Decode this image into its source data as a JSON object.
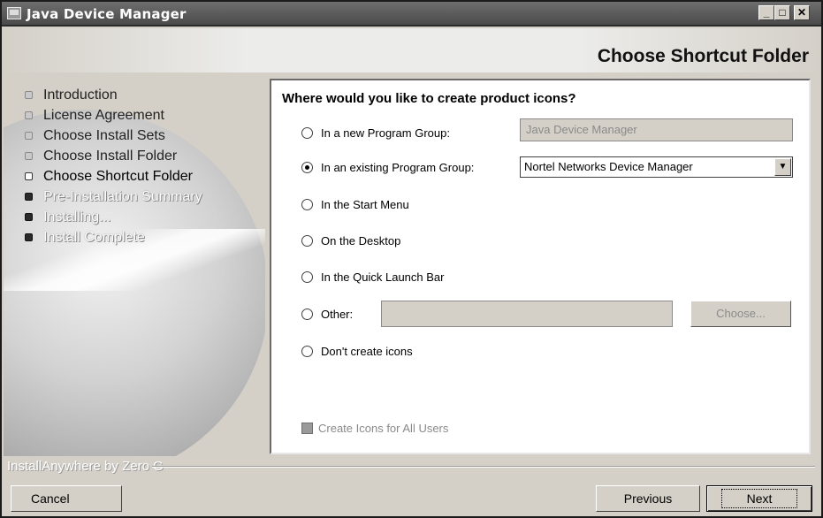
{
  "window": {
    "title": "Java Device Manager",
    "controls": {
      "minimize": "_",
      "maximize": "□",
      "close": "✕"
    }
  },
  "page": {
    "heading": "Choose Shortcut Folder"
  },
  "sidebar": {
    "steps": [
      {
        "label": "Introduction",
        "state": "done"
      },
      {
        "label": "License Agreement",
        "state": "done"
      },
      {
        "label": "Choose Install Sets",
        "state": "done"
      },
      {
        "label": "Choose Install Folder",
        "state": "done"
      },
      {
        "label": "Choose Shortcut Folder",
        "state": "current"
      },
      {
        "label": "Pre-Installation Summary",
        "state": "todo"
      },
      {
        "label": "Installing...",
        "state": "todo"
      },
      {
        "label": "Install Complete",
        "state": "todo"
      }
    ]
  },
  "form": {
    "question": "Where would you like to create product icons?",
    "options": {
      "new_group": {
        "label": "In a new Program Group:",
        "value": "Java Device Manager",
        "selected": false
      },
      "existing_group": {
        "label": "In an existing Program Group:",
        "value": "Nortel Networks Device Manager",
        "selected": true
      },
      "start_menu": {
        "label": "In the Start Menu",
        "selected": false
      },
      "desktop": {
        "label": "On the Desktop",
        "selected": false
      },
      "quick_launch": {
        "label": "In the Quick Launch Bar",
        "selected": false
      },
      "other": {
        "label": "Other:",
        "value": "",
        "selected": false,
        "button": "Choose..."
      },
      "none": {
        "label": "Don't create icons",
        "selected": false
      }
    },
    "all_users": {
      "label": "Create Icons for All Users",
      "checked": true,
      "enabled": false
    }
  },
  "footer": {
    "brand": "InstallAnywhere by Zero G",
    "cancel": "Cancel",
    "previous": "Previous",
    "next": "Next"
  }
}
